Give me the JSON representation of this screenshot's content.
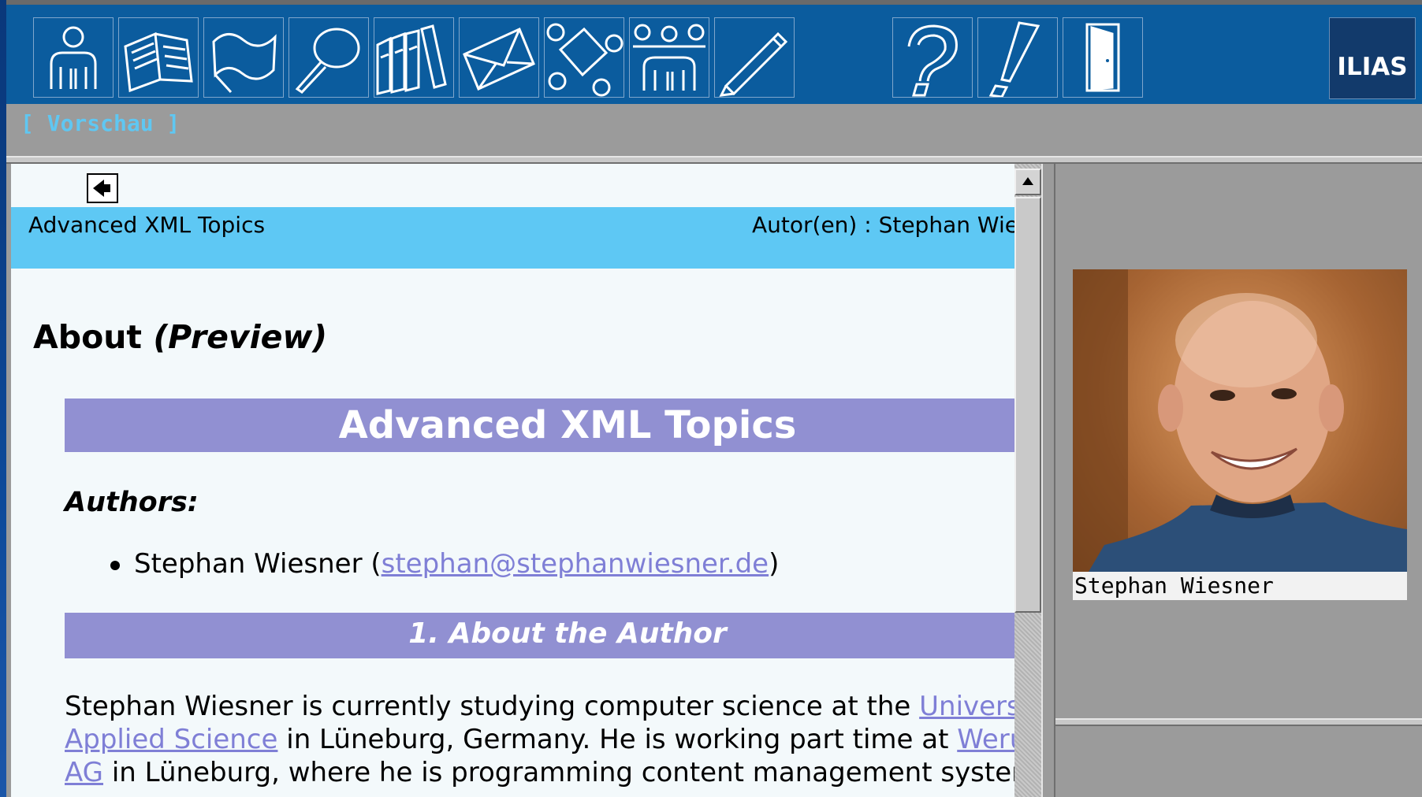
{
  "toolbar": {
    "buttons": [
      {
        "icon": "person-icon"
      },
      {
        "icon": "book-icon"
      },
      {
        "icon": "flag-icon"
      },
      {
        "icon": "magnifier-icon"
      },
      {
        "icon": "library-icon"
      },
      {
        "icon": "mail-icon"
      },
      {
        "icon": "shapes-icon"
      },
      {
        "icon": "group-icon"
      },
      {
        "icon": "pencil-icon"
      },
      {
        "icon": "help-icon"
      },
      {
        "icon": "exclamation-icon"
      },
      {
        "icon": "logout-door-icon"
      }
    ],
    "logo": "ILIAS"
  },
  "preview_link": "[ Vorschau ]",
  "lm_header": {
    "title": "Advanced XML Topics",
    "authors": "Autor(en) : Stephan Wiesner"
  },
  "page": {
    "title_main": "About",
    "title_suffix": "(Preview)",
    "big_heading": "Advanced XML Topics",
    "authors_label": "Authors:",
    "author_name": "Stephan Wiesner (",
    "author_email": "stephan@stephanwiesner.de",
    "author_close": ")",
    "section_heading": "1. About the Author",
    "bio": {
      "t1": "Stephan Wiesner is currently studying computer science at the ",
      "l1": "University of Applied Science",
      "t2": " in Lüneburg, Germany. He is working part time at ",
      "l2": "Werum AG",
      "t3": " in Lüneburg, where he is programming content management systems."
    }
  },
  "right_panel": {
    "photo_caption": "Stephan Wiesner"
  },
  "colors": {
    "toolbar": "#0b5c9e",
    "header_band": "#5ec8f4",
    "heading_band": "#9190d2",
    "link": "#7f7fd6",
    "preview_link": "#5fc7f2"
  }
}
